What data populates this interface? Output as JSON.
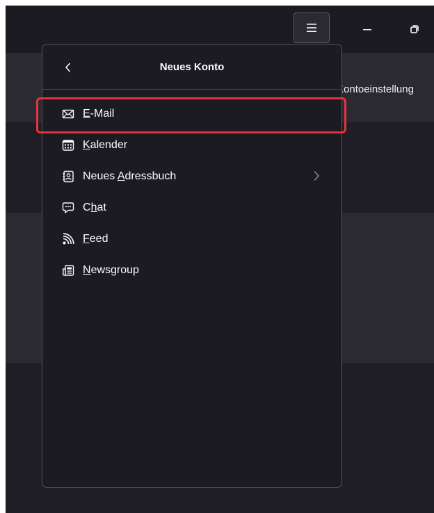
{
  "background": {
    "account_settings_label": "Kontoeinstellung"
  },
  "panel": {
    "title": "Neues Konto",
    "items": [
      {
        "pre": "",
        "access": "E",
        "post": "-Mail",
        "icon": "mail-icon"
      },
      {
        "pre": "",
        "access": "K",
        "post": "alender",
        "icon": "calendar-icon"
      },
      {
        "pre": "Neues ",
        "access": "A",
        "post": "dressbuch",
        "icon": "address-book-icon",
        "submenu": true
      },
      {
        "pre": "C",
        "access": "h",
        "post": "at",
        "icon": "chat-icon"
      },
      {
        "pre": "",
        "access": "F",
        "post": "eed",
        "icon": "feed-icon"
      },
      {
        "pre": "",
        "access": "N",
        "post": "ewsgroup",
        "icon": "newsgroup-icon"
      }
    ]
  },
  "colors": {
    "highlight": "#e5323e",
    "panel_bg": "#1c1b22"
  }
}
